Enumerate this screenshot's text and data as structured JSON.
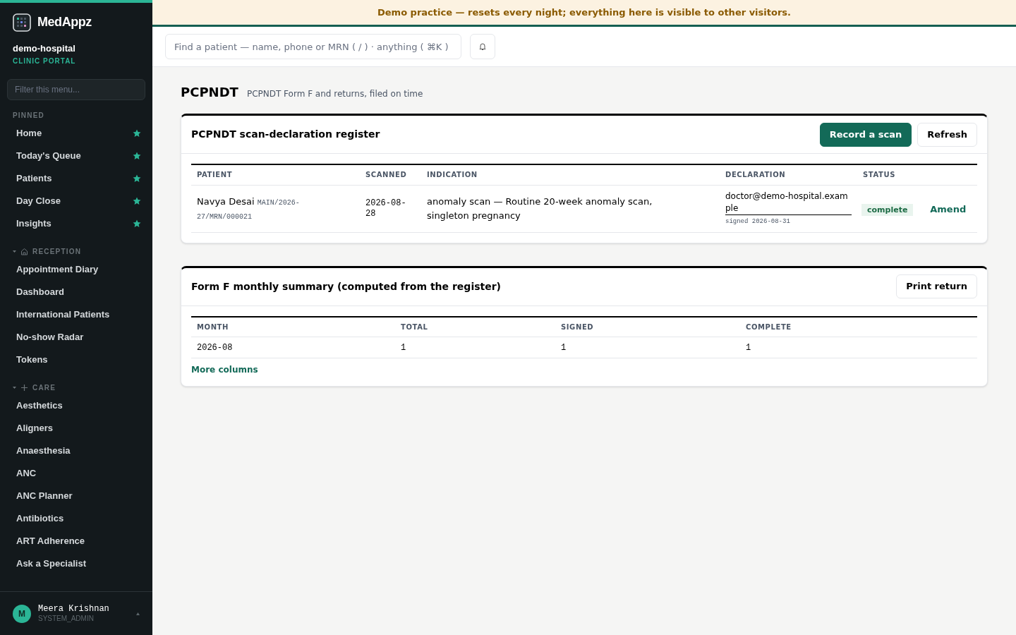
{
  "brand": {
    "name": "MedAppz",
    "org": "demo-hospital",
    "portal": "CLINIC PORTAL"
  },
  "sidebar": {
    "filter_placeholder": "Filter this menu...",
    "sections": [
      {
        "title": "PINNED",
        "kind": "plain",
        "items": [
          {
            "label": "Home",
            "pinned": true
          },
          {
            "label": "Today's Queue",
            "pinned": true
          },
          {
            "label": "Patients",
            "pinned": true
          },
          {
            "label": "Day Close",
            "pinned": true
          },
          {
            "label": "Insights",
            "pinned": true
          }
        ]
      },
      {
        "title": "RECEPTION",
        "kind": "home",
        "expanded": true,
        "items": [
          {
            "label": "Appointment Diary",
            "pinned": false
          },
          {
            "label": "Dashboard",
            "pinned": false
          },
          {
            "label": "International Patients",
            "pinned": false
          },
          {
            "label": "No-show Radar",
            "pinned": false
          },
          {
            "label": "Tokens",
            "pinned": false
          }
        ]
      },
      {
        "title": "CARE",
        "kind": "plus",
        "expanded": true,
        "items": [
          {
            "label": "Aesthetics",
            "pinned": false
          },
          {
            "label": "Aligners",
            "pinned": false
          },
          {
            "label": "Anaesthesia",
            "pinned": false
          },
          {
            "label": "ANC",
            "pinned": false
          },
          {
            "label": "ANC Planner",
            "pinned": false
          },
          {
            "label": "Antibiotics",
            "pinned": false
          },
          {
            "label": "ART Adherence",
            "pinned": false
          },
          {
            "label": "Ask a Specialist",
            "pinned": false
          }
        ]
      }
    ],
    "user": {
      "initial": "M",
      "name": "Meera Krishnan",
      "role": "SYSTEM_ADMIN"
    }
  },
  "banner": "Demo practice — resets every night; everything here is visible to other visitors.",
  "search": {
    "placeholder": "Find a patient — name, phone or MRN ( / ) · anything ( ⌘K )"
  },
  "page": {
    "title": "PCPNDT",
    "subtitle": "PCPNDT Form F and returns, filed on time"
  },
  "register": {
    "title": "PCPNDT scan-declaration register",
    "buttons": [
      {
        "label": "Record a scan",
        "kind": "primary"
      },
      {
        "label": "Refresh",
        "kind": "secondary"
      }
    ],
    "columns": [
      "PATIENT",
      "SCANNED",
      "INDICATION",
      "DECLARATION",
      "STATUS"
    ],
    "rows": [
      {
        "patient": "Navya Desai",
        "mrn": "MAIN/2026-27/MRN/000021",
        "scanned": "2026-08-28",
        "indication": "anomaly scan — Routine 20-week anomaly scan, singleton pregnancy",
        "declaration": "doctor@demo-hospital.example",
        "signed": "signed 2026-08-31",
        "status": "complete",
        "action": "Amend"
      }
    ]
  },
  "summary": {
    "title": "Form F monthly summary (computed from the register)",
    "button": "Print return",
    "columns": [
      "MONTH",
      "TOTAL",
      "SIGNED",
      "COMPLETE"
    ],
    "rows": [
      [
        "2026-08",
        "1",
        "1",
        "1"
      ]
    ],
    "link": "More columns"
  }
}
